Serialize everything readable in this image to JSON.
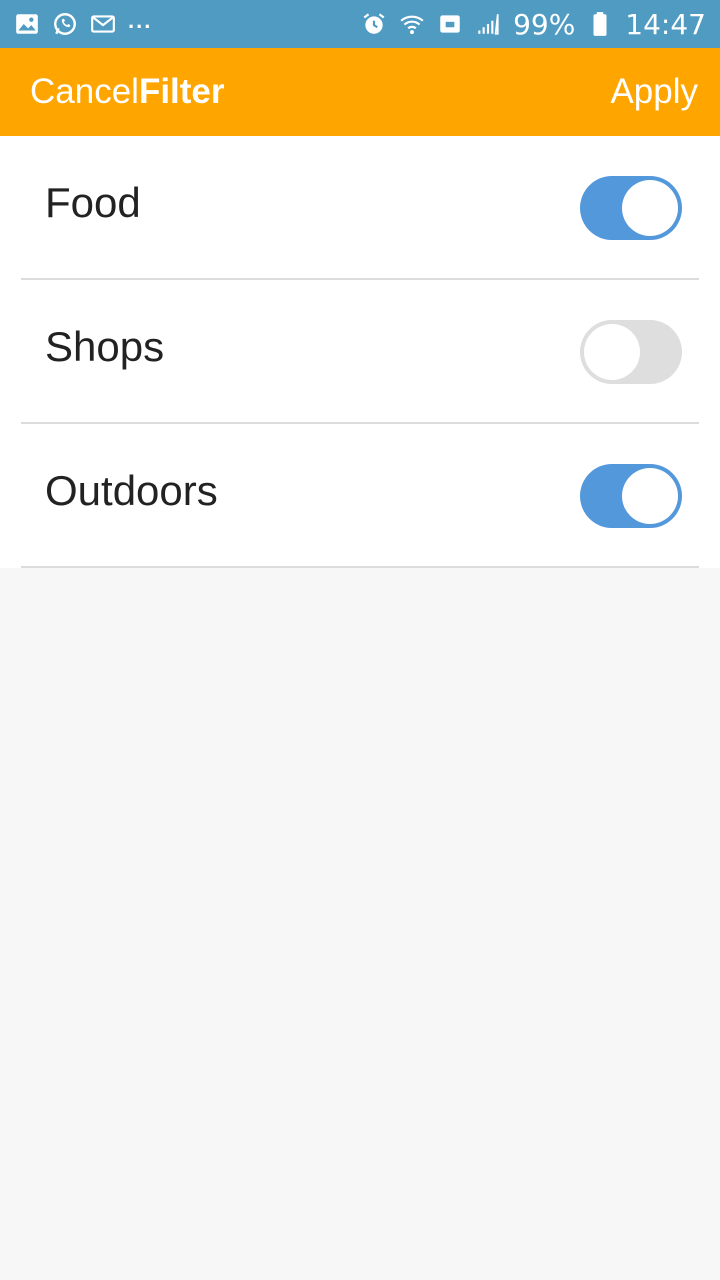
{
  "status_bar": {
    "left_icons": [
      "gallery-icon",
      "whatsapp-icon",
      "mail-icon"
    ],
    "more": "...",
    "right_icons": [
      "alarm-icon",
      "wifi-icon",
      "sync-icon",
      "signal-icon"
    ],
    "battery_text": "99%",
    "time": "14:47"
  },
  "app_bar": {
    "cancel_label": "Cancel",
    "title": "Filter",
    "apply_label": "Apply",
    "color": "#ffa500"
  },
  "filters": [
    {
      "label": "Food",
      "enabled": true
    },
    {
      "label": "Shops",
      "enabled": false
    },
    {
      "label": "Outdoors",
      "enabled": true
    }
  ],
  "colors": {
    "status_bar": "#4f9bc2",
    "toggle_on": "#5498dc",
    "toggle_off": "#dedede"
  }
}
